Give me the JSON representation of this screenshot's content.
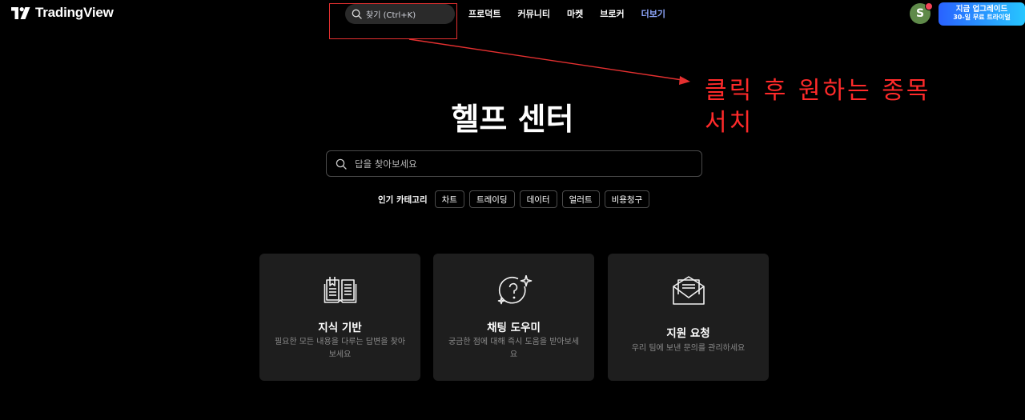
{
  "logo": {
    "text": "TradingView"
  },
  "search": {
    "label": "찾기 (Ctrl+K)"
  },
  "nav": [
    {
      "label": "프로덕트"
    },
    {
      "label": "커뮤니티"
    },
    {
      "label": "마켓"
    },
    {
      "label": "브로커"
    },
    {
      "label": "더보기"
    }
  ],
  "avatar": {
    "initial": "S"
  },
  "upgrade": {
    "line1": "지금 업그레이드",
    "line2": "30-일 무료 트라이얼"
  },
  "annotation": {
    "line1": "클릭 후 원하는 종목",
    "line2": "서치"
  },
  "hero": {
    "title": "헬프 센터",
    "search_placeholder": "답을 찾아보세요"
  },
  "popular": {
    "label": "인기 카테고리",
    "chips": [
      "차트",
      "트레이딩",
      "데이터",
      "얼러트",
      "비용청구"
    ]
  },
  "cards": [
    {
      "icon": "book-icon",
      "title": "지식 기반",
      "desc": "필요한 모든 내용을 다루는 답변을 찾아보세요"
    },
    {
      "icon": "question-sparkle-icon",
      "title": "채팅 도우미",
      "desc": "궁금한 점에 대해 즉시 도움을 받아보세요"
    },
    {
      "icon": "envelope-icon",
      "title": "지원 요청",
      "desc": "우리 팀에 보낸 문의를 관리하세요"
    }
  ],
  "colors": {
    "accent_more": "#8fa8ff",
    "annotation": "#ff2a2a",
    "card_bg": "#1e1e1e",
    "upgrade_from": "#2962ff",
    "upgrade_to": "#27c6ff"
  }
}
